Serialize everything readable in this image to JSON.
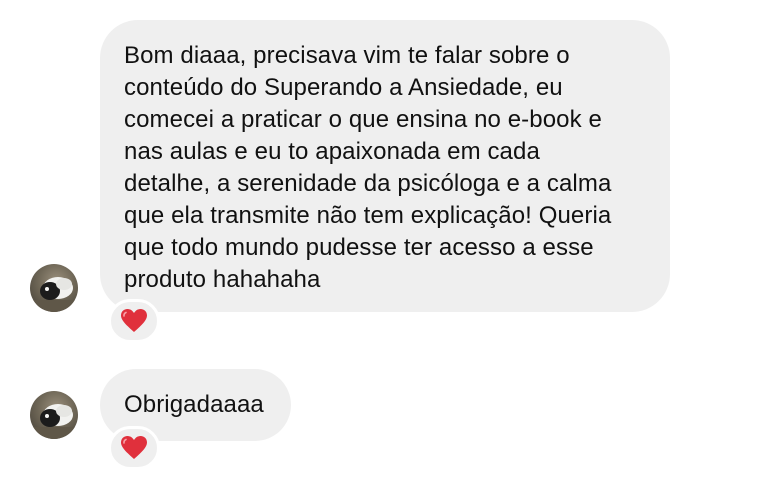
{
  "messages": [
    {
      "text": "Bom diaaa, precisava vim te falar sobre o\nconteúdo do Superando a Ansiedade, eu\ncomecei a praticar o que ensina no e-book e\nnas aulas e eu to apaixonada em cada\ndetalhe, a serenidade da psicóloga e a calma\nque ela transmite não tem explicação! Queria\nque todo mundo pudesse ter acesso a esse\nproduto hahahaha",
      "reaction_icon": "red-heart-icon"
    },
    {
      "text": "Obrigadaaaa",
      "reaction_icon": "red-heart-icon"
    }
  ],
  "colors": {
    "bubble": "#efefef",
    "text": "#111111",
    "heart": "#e0303c",
    "background": "#ffffff"
  }
}
